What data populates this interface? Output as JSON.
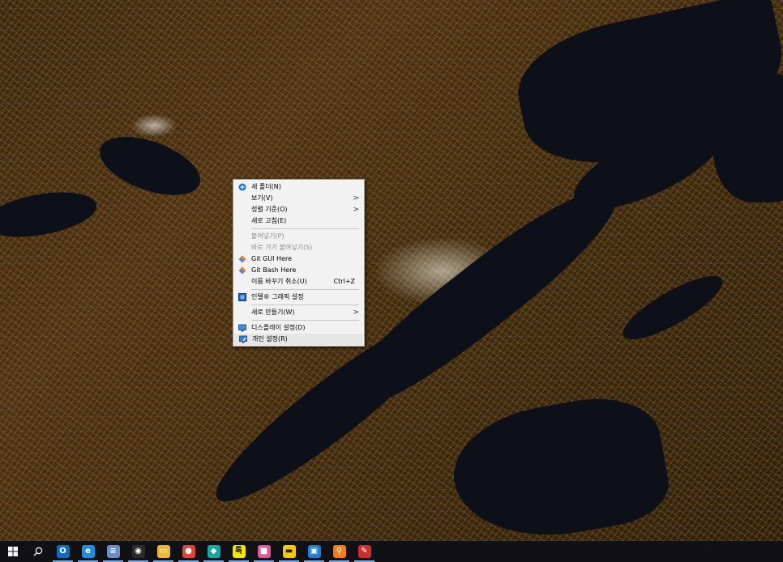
{
  "context_menu": {
    "items": [
      {
        "name": "new-folder",
        "label": "새 폴더(N)",
        "icon": "blue-circle-icon",
        "disabled": false
      },
      {
        "name": "view",
        "label": "보기(V)",
        "submenu": true,
        "disabled": false
      },
      {
        "name": "sort-by",
        "label": "정렬 기준(O)",
        "submenu": true,
        "disabled": false
      },
      {
        "name": "refresh",
        "label": "새로 고침(E)",
        "disabled": false
      },
      {
        "name": "paste",
        "label": "붙여넣기(P)",
        "disabled": true
      },
      {
        "name": "paste-shortcut",
        "label": "바로 가기 붙여넣기(S)",
        "disabled": true
      },
      {
        "name": "git-gui",
        "label": "Git GUI Here",
        "icon": "git-icon",
        "disabled": false
      },
      {
        "name": "git-bash",
        "label": "Git Bash Here",
        "icon": "git-icon",
        "disabled": false
      },
      {
        "name": "undo-rename",
        "label": "이름 바꾸기 취소(U)",
        "shortcut": "Ctrl+Z",
        "disabled": false
      },
      {
        "name": "intel-graphics",
        "label": "인텔® 그래픽 설정",
        "icon": "intel-graphics-icon",
        "disabled": false
      },
      {
        "name": "new",
        "label": "새로 만들기(W)",
        "submenu": true,
        "disabled": false
      },
      {
        "name": "display-settings",
        "label": "디스플레이 설정(D)",
        "icon": "display-icon",
        "disabled": false
      },
      {
        "name": "personalize",
        "label": "개인 설정(R)",
        "icon": "personalize-icon",
        "disabled": false
      }
    ],
    "submenu_arrow": ">"
  },
  "taskbar": {
    "start_icon": "windows-start-icon",
    "search_icon": "search-icon",
    "apps": [
      {
        "name": "outlook",
        "glyph": "O",
        "color": "#0f6cbd"
      },
      {
        "name": "internet-explorer",
        "glyph": "e",
        "color": "#1c8fe0"
      },
      {
        "name": "notepad",
        "glyph": "≡",
        "color": "#6a8fc4"
      },
      {
        "name": "chromium",
        "glyph": "◉",
        "color": "#2b2b2b"
      },
      {
        "name": "file-explorer",
        "glyph": "▭",
        "color": "#e9b83b"
      },
      {
        "name": "chrome",
        "glyph": "●",
        "color": "#db4437"
      },
      {
        "name": "app-teal",
        "glyph": "◆",
        "color": "#1aa6a0"
      },
      {
        "name": "kakaotalk",
        "glyph": "톡",
        "color": "#f7e600"
      },
      {
        "name": "pink-app",
        "glyph": "■",
        "color": "#e05a9a"
      },
      {
        "name": "sticky-notes",
        "glyph": "▬",
        "color": "#f2c811"
      },
      {
        "name": "blue-app",
        "glyph": "▣",
        "color": "#1d7fd1"
      },
      {
        "name": "search-tool",
        "glyph": "⚲",
        "color": "#f07d1a"
      },
      {
        "name": "adobe-app",
        "glyph": "✎",
        "color": "#c8302f"
      }
    ]
  }
}
